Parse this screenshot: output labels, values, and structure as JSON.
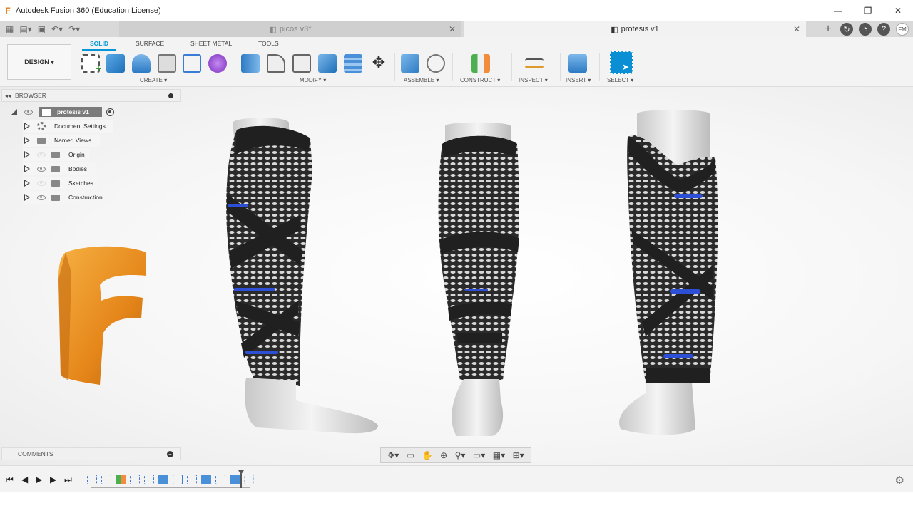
{
  "window": {
    "title": "Autodesk Fusion 360 (Education License)",
    "logo_icon": "fusion-logo-icon",
    "controls": [
      "—",
      "❐",
      "✕"
    ]
  },
  "tabs": [
    {
      "label": "picos v3*",
      "active": false,
      "close": "✕"
    },
    {
      "label": "protesis v1",
      "active": true,
      "close": "✕"
    }
  ],
  "tab_tools": {
    "user_initials": "FM"
  },
  "toolbar": {
    "workspace": "DESIGN ▾",
    "workspace_tabs": [
      "SOLID",
      "SURFACE",
      "SHEET METAL",
      "TOOLS"
    ],
    "groups": [
      {
        "label": "CREATE ▾"
      },
      {
        "label": "MODIFY ▾"
      },
      {
        "label": "ASSEMBLE ▾"
      },
      {
        "label": "CONSTRUCT ▾"
      },
      {
        "label": "INSPECT ▾"
      },
      {
        "label": "INSERT ▾"
      },
      {
        "label": "SELECT ▾"
      }
    ],
    "accent": "#0696d7"
  },
  "browser": {
    "title": "BROWSER",
    "root": "protesis v1",
    "items": [
      {
        "label": "Document Settings",
        "icon": "gear-icon"
      },
      {
        "label": "Named Views",
        "icon": "folder-icon"
      },
      {
        "label": "Origin",
        "icon": "folder-icon"
      },
      {
        "label": "Bodies",
        "icon": "folder-icon"
      },
      {
        "label": "Sketches",
        "icon": "folder-icon"
      },
      {
        "label": "Construction",
        "icon": "folder-icon"
      }
    ]
  },
  "comments": {
    "title": "COMMENTS"
  },
  "navbar": {
    "icons": [
      "orbit-icon",
      "look-at-icon",
      "pan-icon",
      "zoom-window-icon",
      "zoom-icon",
      "display-settings-icon",
      "grid-icon",
      "viewports-icon"
    ]
  },
  "timeline": {
    "controls": [
      "⏮",
      "◀",
      "▶",
      "▶",
      "⏭"
    ],
    "feature_count": 12
  }
}
